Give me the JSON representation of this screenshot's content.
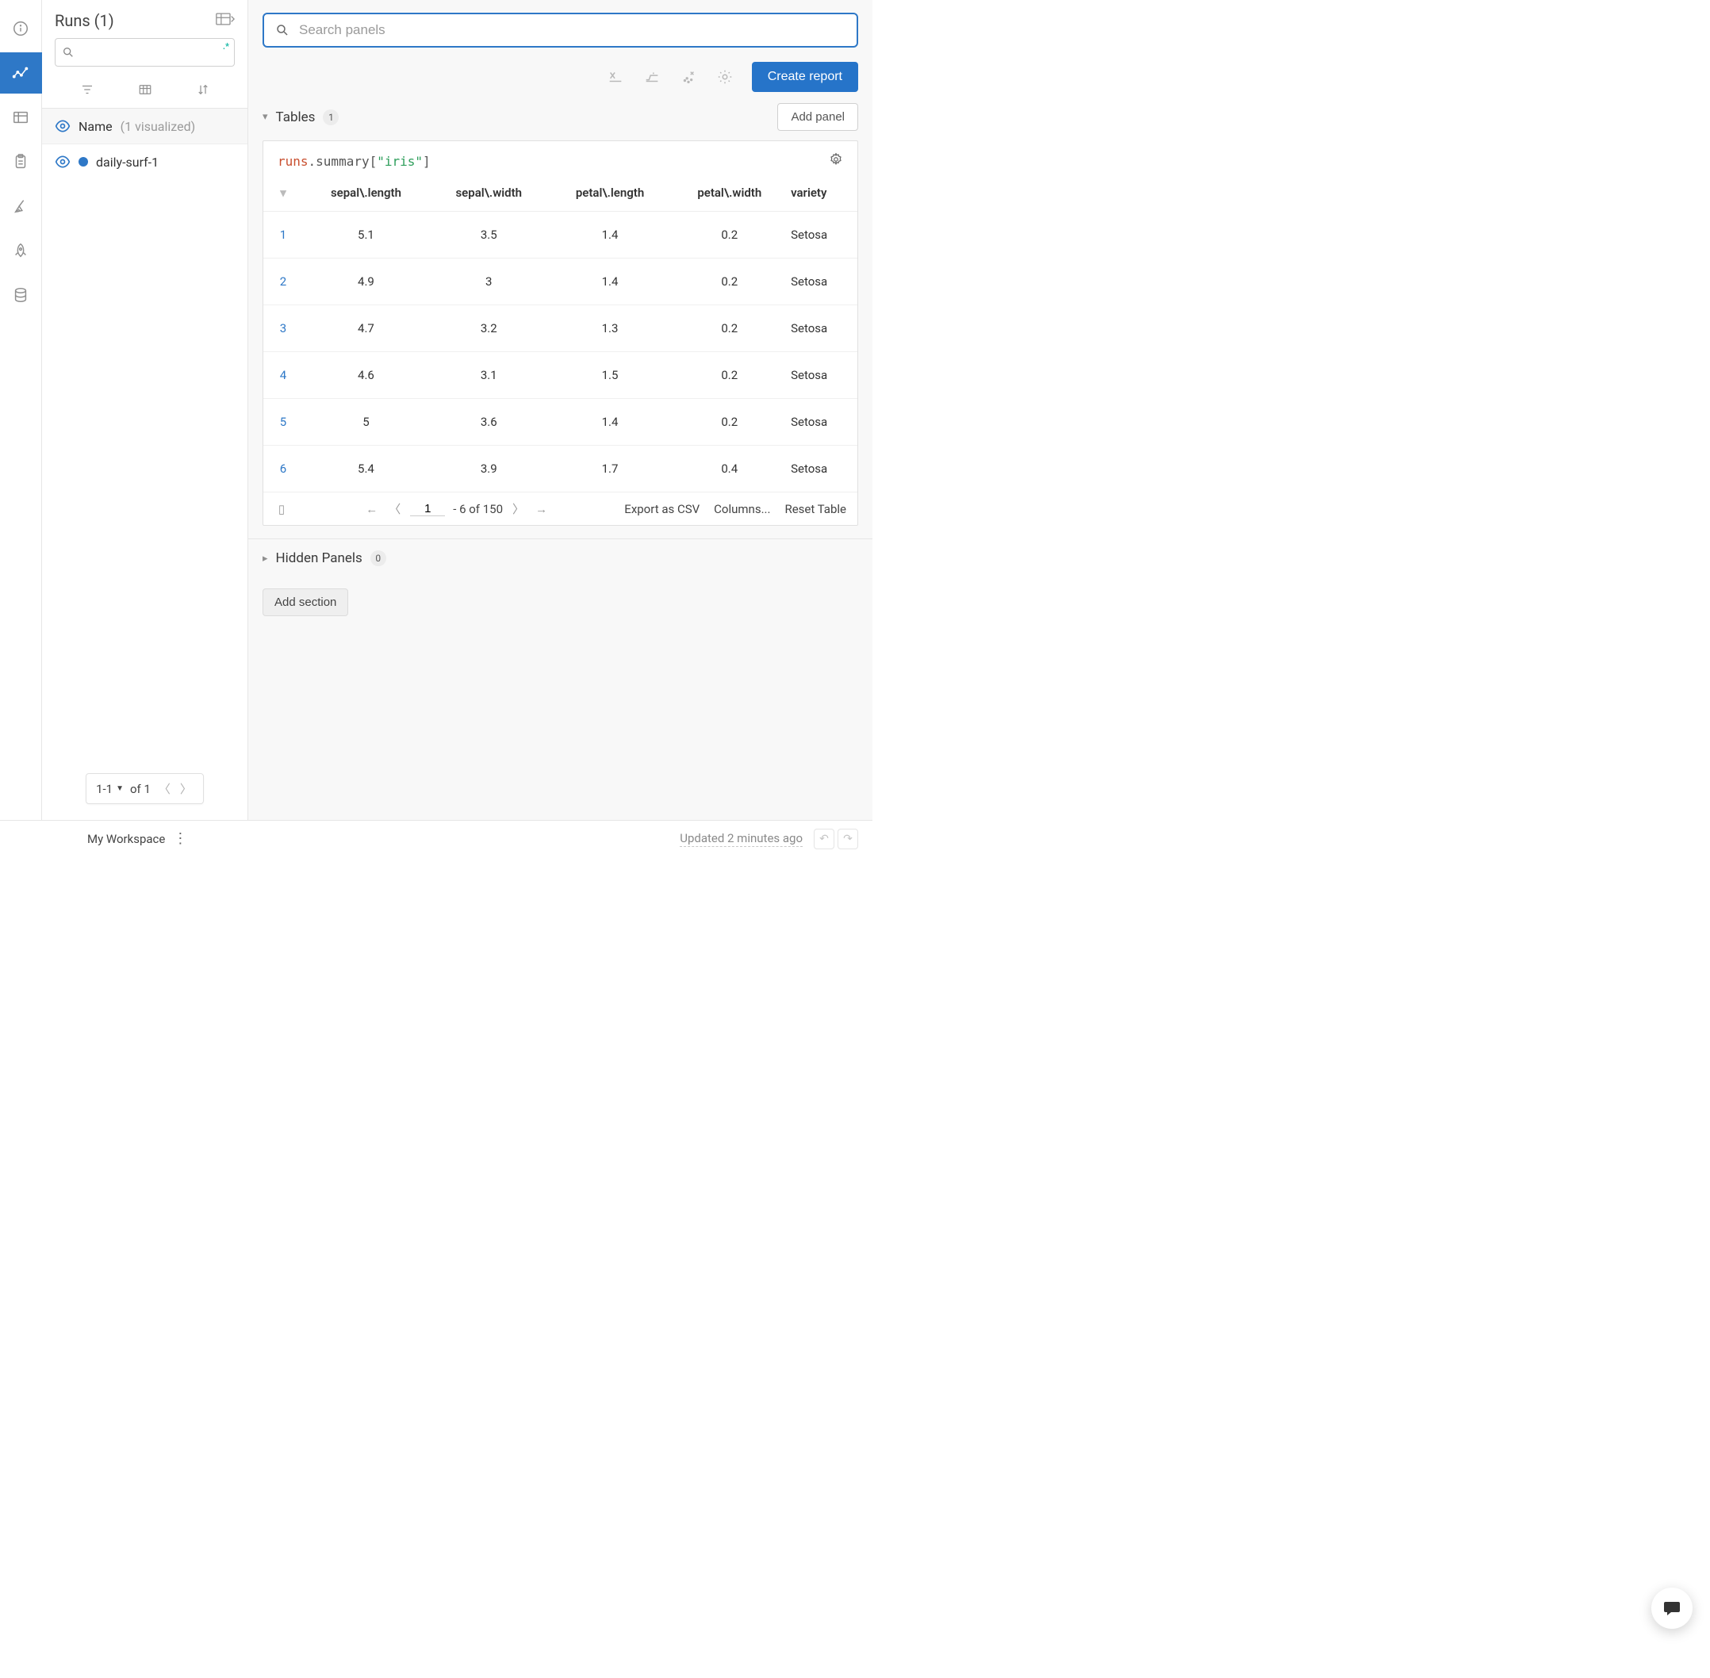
{
  "iconbar": {
    "items": [
      "info",
      "charts",
      "table",
      "clipboard",
      "broom",
      "rocket",
      "database"
    ],
    "active_index": 1
  },
  "sidebar": {
    "title": "Runs (1)",
    "search_placeholder": "",
    "group_header": {
      "label": "Name",
      "hint": "(1 visualized)"
    },
    "runs": [
      {
        "name": "daily-surf-1",
        "color": "#2e78c7"
      }
    ],
    "pager": {
      "range": "1-1",
      "of_label": "of 1"
    }
  },
  "toolbar": {
    "search_placeholder": "Search panels",
    "create_report_label": "Create report",
    "add_panel_label": "Add panel"
  },
  "section_tables": {
    "title": "Tables",
    "count": "1",
    "panel": {
      "title_parts": {
        "a": "runs",
        "b": ".summary[",
        "c": "\"iris\"",
        "d": "]"
      },
      "columns": [
        "sepal\\.length",
        "sepal\\.width",
        "petal\\.length",
        "petal\\.width",
        "variety"
      ],
      "rows": [
        {
          "idx": "1",
          "cells": [
            "5.1",
            "3.5",
            "1.4",
            "0.2",
            "Setosa"
          ]
        },
        {
          "idx": "2",
          "cells": [
            "4.9",
            "3",
            "1.4",
            "0.2",
            "Setosa"
          ]
        },
        {
          "idx": "3",
          "cells": [
            "4.7",
            "3.2",
            "1.3",
            "0.2",
            "Setosa"
          ]
        },
        {
          "idx": "4",
          "cells": [
            "4.6",
            "3.1",
            "1.5",
            "0.2",
            "Setosa"
          ]
        },
        {
          "idx": "5",
          "cells": [
            "5",
            "3.6",
            "1.4",
            "0.2",
            "Setosa"
          ]
        },
        {
          "idx": "6",
          "cells": [
            "5.4",
            "3.9",
            "1.7",
            "0.4",
            "Setosa"
          ]
        }
      ],
      "footer": {
        "page_value": "1",
        "range_suffix": "- 6 of 150",
        "export_label": "Export as CSV",
        "columns_label": "Columns...",
        "reset_label": "Reset Table"
      }
    }
  },
  "section_hidden": {
    "title": "Hidden Panels",
    "count": "0"
  },
  "add_section_label": "Add section",
  "statusbar": {
    "workspace": "My Workspace",
    "updated": "Updated 2 minutes ago"
  }
}
